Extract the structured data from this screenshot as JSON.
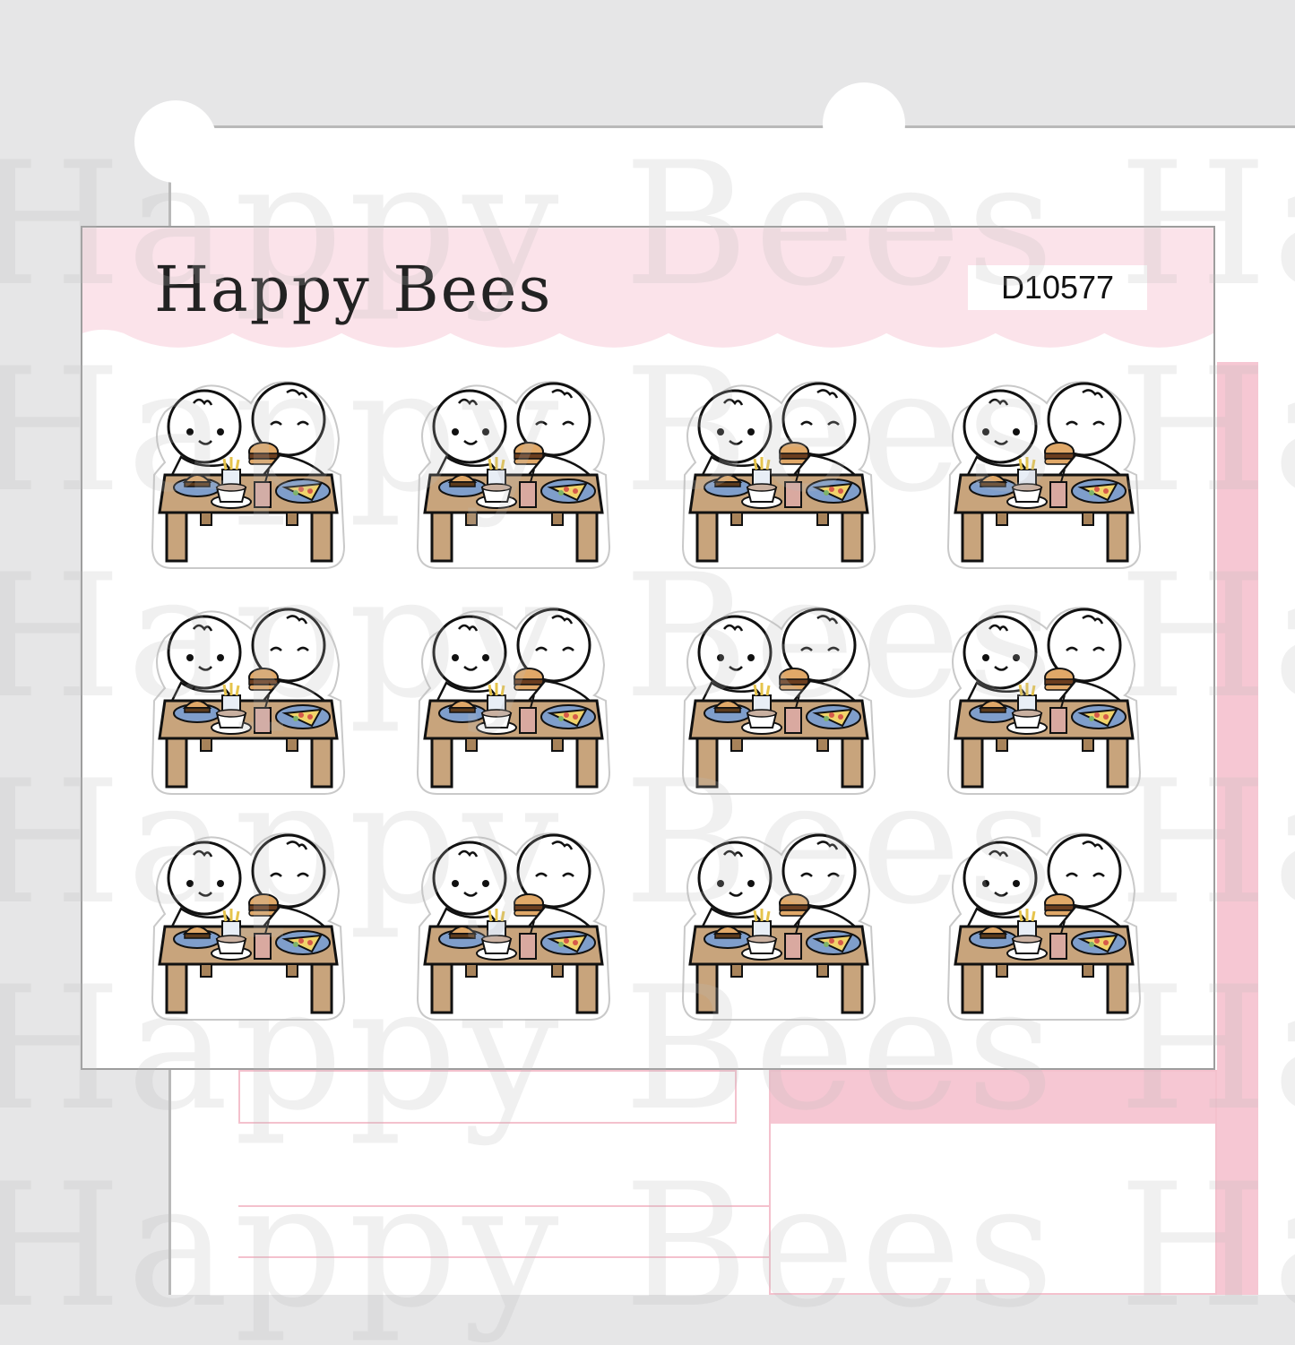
{
  "brand": {
    "name": "Happy Bees"
  },
  "product": {
    "code": "D10577"
  },
  "watermark": {
    "text": "Happy Bees Happy"
  },
  "colors": {
    "header_pink": "#fbe3ea",
    "accent_pink": "#f6c7d3",
    "table_wood": "#c8a47c",
    "plate_blue": "#7f9ecb"
  },
  "stickers": {
    "rows": 3,
    "columns": 4,
    "subject": "two characters eating burgers, fries and drinks at a table"
  }
}
